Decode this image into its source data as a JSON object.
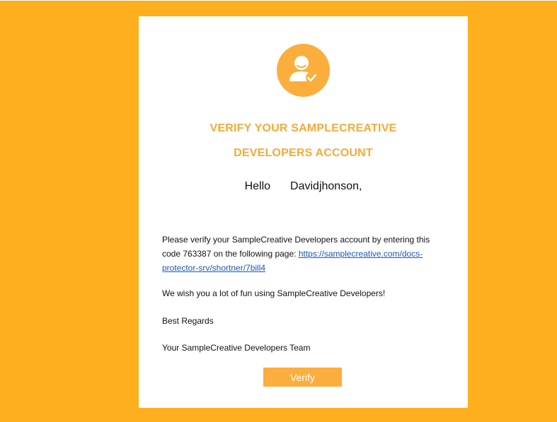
{
  "colors": {
    "background": "#FDAF1D",
    "accent": "#FBAE3C",
    "title": "#F6A93A",
    "link": "#1a57b8"
  },
  "header": {
    "icon": "verified-user-icon"
  },
  "title": {
    "line1": "VERIFY YOUR SAMPLECREATIVE",
    "line2": "DEVELOPERS ACCOUNT"
  },
  "greeting": {
    "hello": "Hello",
    "name": "Davidjhonson,"
  },
  "message": {
    "intro_before_link": "Please verify your SampleCreative Developers account by entering this code 763387 on the following page: ",
    "link_text": "https://samplecreative.com/docs-protector-srv/shortner/7bill4",
    "fun": "We wish you a lot of fun using SampleCreative Developers!",
    "regards": "Best Regards",
    "signature": "Your SampleCreative Developers Team"
  },
  "button": {
    "label": "Verify"
  }
}
